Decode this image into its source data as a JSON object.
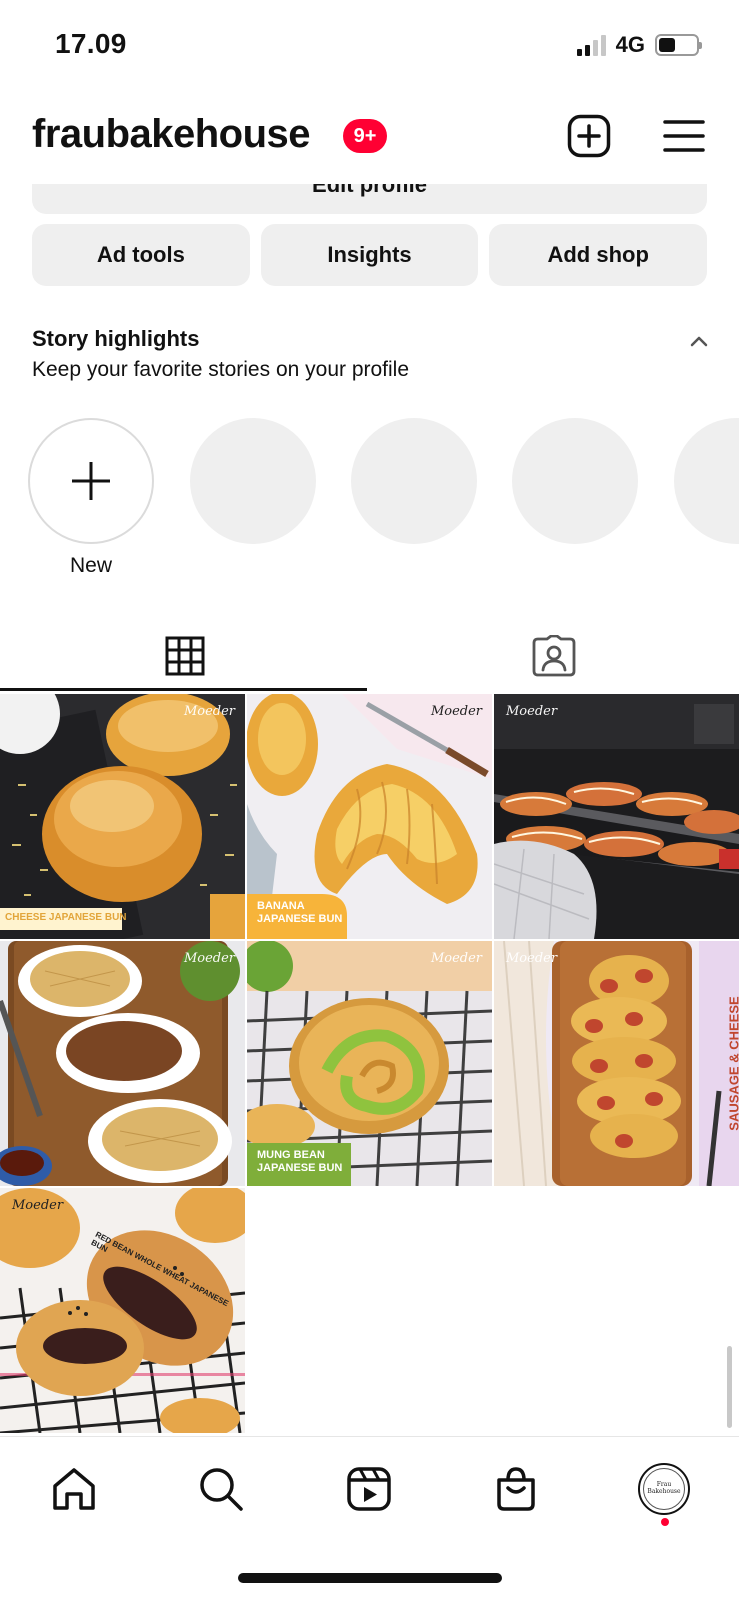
{
  "status_bar": {
    "time": "17.09",
    "network": "4G",
    "battery_level": 0.45
  },
  "header": {
    "username": "fraubakehouse",
    "badge": "9+"
  },
  "profile_actions": {
    "edit_profile": "Edit profile",
    "buttons": [
      "Ad tools",
      "Insights",
      "Add shop"
    ]
  },
  "highlights": {
    "title": "Story highlights",
    "subtitle": "Keep your favorite stories on your profile",
    "new_label": "New"
  },
  "posts": [
    {
      "caption": "CHEESE JAPANESE BUN",
      "watermark": "Moeder"
    },
    {
      "caption": "BANANA JAPANESE BUN",
      "watermark": "Moeder"
    },
    {
      "caption": "",
      "watermark": "Moeder"
    },
    {
      "caption": "",
      "watermark": "Moeder"
    },
    {
      "caption": "MUNG BEAN JAPANESE BUN",
      "watermark": "Moeder"
    },
    {
      "caption": "SAUSAGE & CHEESE",
      "watermark": "Moeder"
    },
    {
      "caption": "RED BEAN WHOLE WHEAT JAPANESE BUN",
      "watermark": "Moeder"
    }
  ],
  "nav": {
    "items": [
      "home-icon",
      "search-icon",
      "reels-icon",
      "shop-icon",
      "profile-avatar"
    ],
    "avatar_text": "Frau Bakehouse"
  },
  "colors": {
    "badge": "#ff0033",
    "button_bg": "#efefef",
    "text": "#111111"
  }
}
